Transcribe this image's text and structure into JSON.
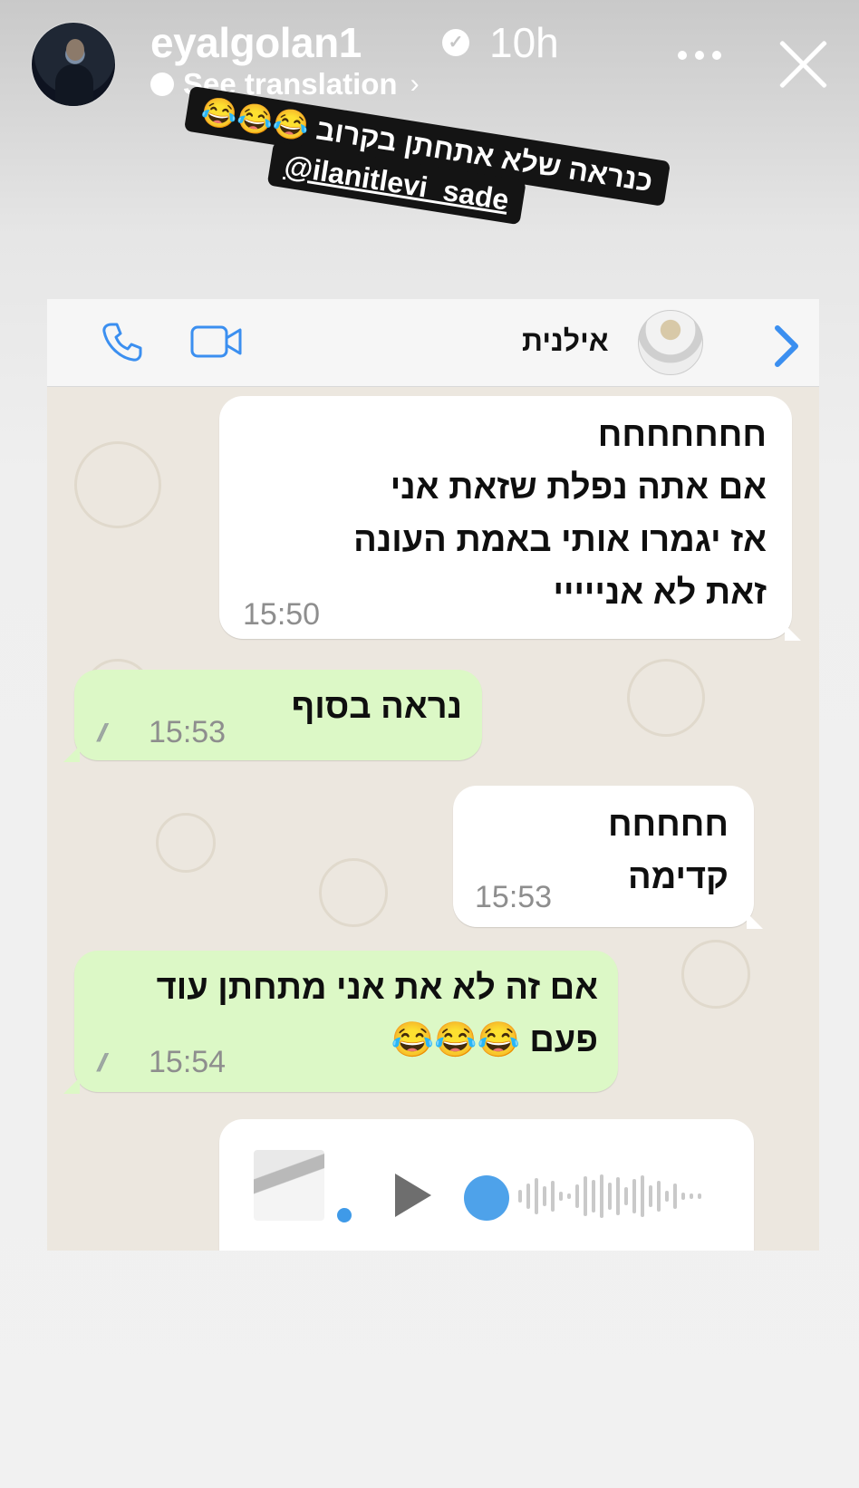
{
  "story": {
    "username": "eyalgolan1",
    "time": "10h",
    "see_translation": "See translation",
    "caption_line1": "כנראה שלא אתחתן בקרוב 😂😂😂",
    "caption_line2": "@ilanitlevi_sade"
  },
  "chat": {
    "contact_name": "אילנית",
    "messages": [
      {
        "direction": "in",
        "lines": [
          "חחחחחחח",
          "אם אתה נפלת שזאת אני",
          "אז יגמרו אותי באמת העונה",
          "זאת לא אנייייי"
        ],
        "time": "15:50"
      },
      {
        "direction": "out",
        "lines": [
          "נראה בסוף"
        ],
        "time": "15:53"
      },
      {
        "direction": "in",
        "lines": [
          "חחחחח",
          "קדימה"
        ],
        "time": "15:53"
      },
      {
        "direction": "out",
        "lines": [
          "אם זה לא את אני מתחתן עוד",
          "פעם 😂😂😂"
        ],
        "time": "15:54"
      }
    ]
  },
  "colors": {
    "incoming_bubble": "#ffffff",
    "outgoing_bubble": "#dcf8c6",
    "ios_blue": "#3b8ff0",
    "chat_background": "#ece7df"
  },
  "icons": [
    "more-icon",
    "close-icon",
    "call-icon",
    "video-call-icon",
    "back-chevron-icon",
    "play-icon"
  ]
}
